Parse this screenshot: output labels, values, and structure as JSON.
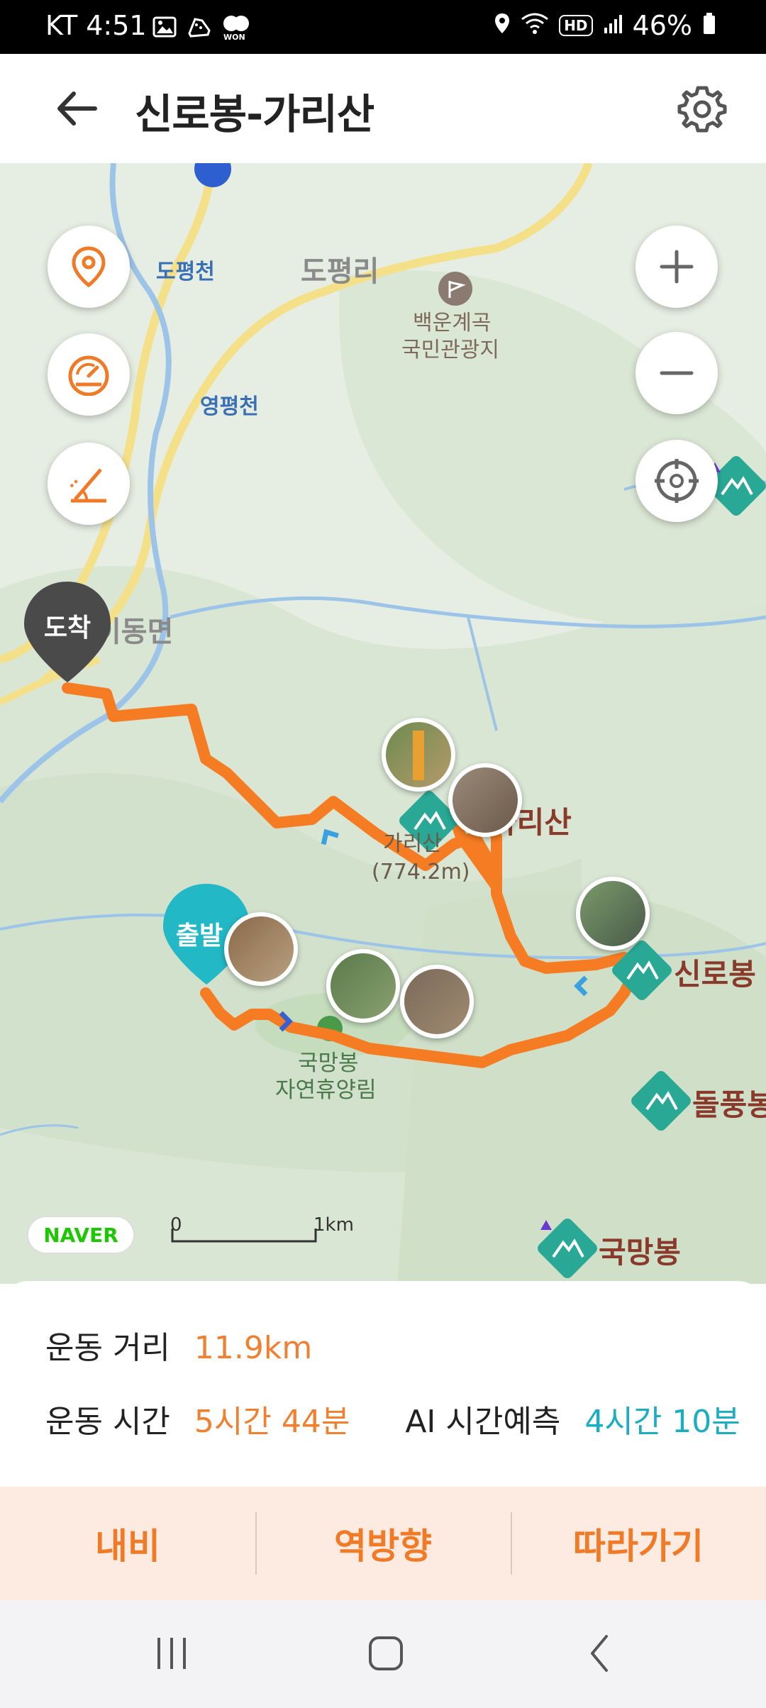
{
  "status_bar": {
    "time": "KT 4:51",
    "left_icons": [
      "gallery-icon",
      "shoe-icon",
      "won-icon"
    ],
    "won_label": "WON",
    "right_icons": [
      "location-icon",
      "wifi-icon",
      "hd-icon",
      "signal-icon",
      "battery-icon"
    ],
    "hd_label": "HD",
    "battery": "46%"
  },
  "header": {
    "title": "신로봉-가리산",
    "back_icon": "back-arrow-icon",
    "settings_icon": "gear-icon"
  },
  "map": {
    "labels": {
      "dopyeongcheon": "도평천",
      "dopyeongri": "도평리",
      "baekun_1": "백운계곡",
      "baekun_2": "국민관광지",
      "yeongpyeongcheon": "영평천",
      "idongmyeon": "이동면",
      "garisan_name": "가리산",
      "garisan_alt": "(774.2m)",
      "garisan_peak": "가리산",
      "sinrobong": "신로봉",
      "dolpungbong": "돌풍봉",
      "gukmangbong_forest_1": "국망봉",
      "gukmangbong_forest_2": "자연휴양림",
      "gukmangbong_peak": "국망봉"
    },
    "markers": {
      "arrival": "도착",
      "departure": "출발"
    },
    "controls": {
      "left": [
        "location-pin-icon",
        "speedometer-icon",
        "slope-icon"
      ],
      "right": [
        "zoom-in-icon",
        "zoom-out-icon",
        "crosshair-icon"
      ]
    },
    "attribution": "NAVER",
    "scale_start": "0",
    "scale_end": "1km",
    "route_color": "#f57c22"
  },
  "info": {
    "distance_label": "운동 거리",
    "distance_value": "11.9km",
    "time_label": "운동 시간",
    "time_value": "5시간 44분",
    "ai_label": "AI 시간예측",
    "ai_value": "4시간 10분"
  },
  "actions": {
    "nav": "내비",
    "reverse": "역방향",
    "follow": "따라가기"
  },
  "navbar": {
    "icons": [
      "recent-apps-icon",
      "home-icon",
      "back-icon"
    ]
  }
}
